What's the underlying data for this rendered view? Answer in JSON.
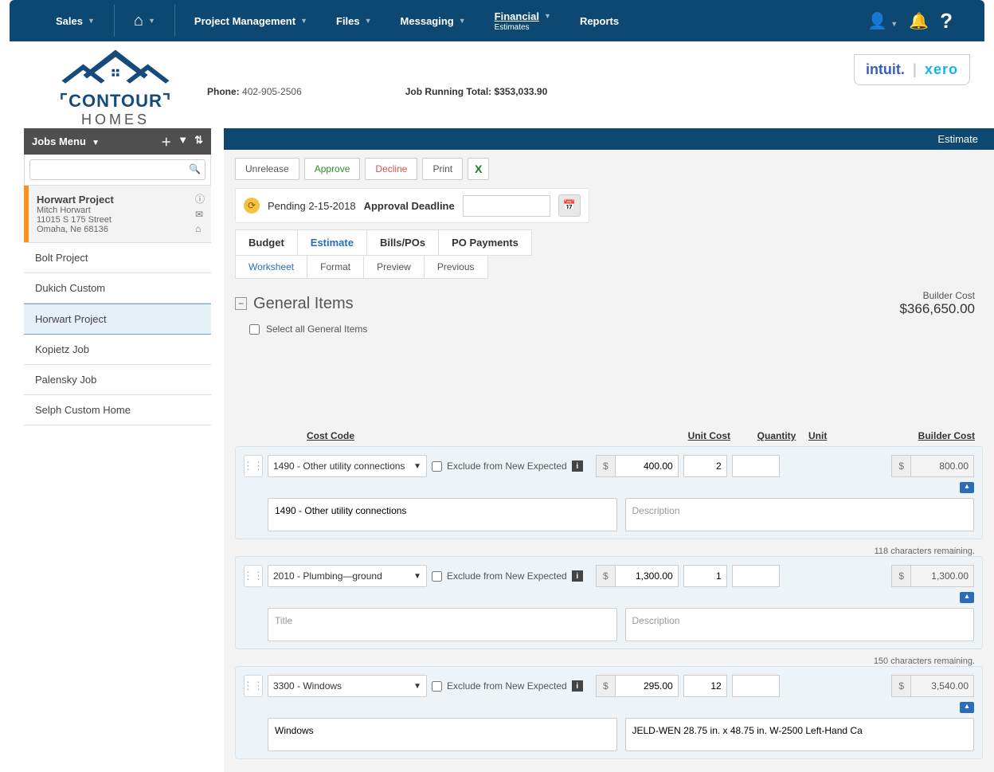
{
  "nav": {
    "sales": "Sales",
    "project": "Project Management",
    "files": "Files",
    "messaging": "Messaging",
    "financial": "Financial",
    "financial_sub": "Estimates",
    "reports": "Reports"
  },
  "integrations": {
    "intuit": "intuit.",
    "xero": "xero"
  },
  "header": {
    "phone_label": "Phone:",
    "phone": "402-905-2506",
    "total_label": "Job Running Total:",
    "total": "$353,033.90"
  },
  "logo": {
    "line1": "CONTOUR",
    "line2": "HOMES"
  },
  "sidebar": {
    "title": "Jobs Menu",
    "search_placeholder": "",
    "card": {
      "title": "Horwart Project",
      "contact": "Mitch Horwart",
      "street": "11015 S 175 Street",
      "city": "Omaha, Ne 68136"
    },
    "items": [
      {
        "label": "Bolt Project",
        "active": false
      },
      {
        "label": "Dukich Custom",
        "active": false
      },
      {
        "label": "Horwart Project",
        "active": true
      },
      {
        "label": "Kopietz Job",
        "active": false
      },
      {
        "label": "Palensky Job",
        "active": false
      },
      {
        "label": "Selph Custom Home",
        "active": false
      }
    ]
  },
  "content_title": "Estimate",
  "actions": {
    "unrelease": "Unrelease",
    "approve": "Approve",
    "decline": "Decline",
    "print": "Print"
  },
  "status": {
    "pending": "Pending 2-15-2018",
    "deadline_label": "Approval Deadline"
  },
  "tabs": {
    "main": [
      {
        "label": "Budget"
      },
      {
        "label": "Estimate",
        "active": true
      },
      {
        "label": "Bills/POs"
      },
      {
        "label": "PO Payments"
      }
    ],
    "sub": [
      {
        "label": "Worksheet",
        "active": true
      },
      {
        "label": "Format"
      },
      {
        "label": "Preview"
      },
      {
        "label": "Previous"
      }
    ]
  },
  "section": {
    "title": "General Items",
    "select_all": "Select all General Items",
    "builder_cost_label": "Builder Cost",
    "builder_cost": "$366,650.00"
  },
  "cols": {
    "code": "Cost Code",
    "unit": "Unit Cost",
    "qty": "Quantity",
    "u": "Unit",
    "bc": "Builder Cost"
  },
  "exclude_label": "Exclude from New Expected",
  "lines": [
    {
      "code": "1490 - Other utility connections",
      "unit_cost": "400.00",
      "qty": "2",
      "unit": "",
      "builder_cost": "800.00",
      "title": "1490 - Other utility connections",
      "desc": "",
      "desc_ph": "Description",
      "remain": "118 characters remaining."
    },
    {
      "code": "2010 - Plumbing—ground",
      "unit_cost": "1,300.00",
      "qty": "1",
      "unit": "",
      "builder_cost": "1,300.00",
      "title": "",
      "title_ph": "Title",
      "desc": "",
      "desc_ph": "Description",
      "remain": "150 characters remaining."
    },
    {
      "code": "3300 - Windows",
      "unit_cost": "295.00",
      "qty": "12",
      "unit": "",
      "builder_cost": "3,540.00",
      "title": "Windows",
      "desc": "JELD-WEN 28.75 in. x 48.75 in. W-2500 Left-Hand Ca",
      "remain": ""
    }
  ]
}
